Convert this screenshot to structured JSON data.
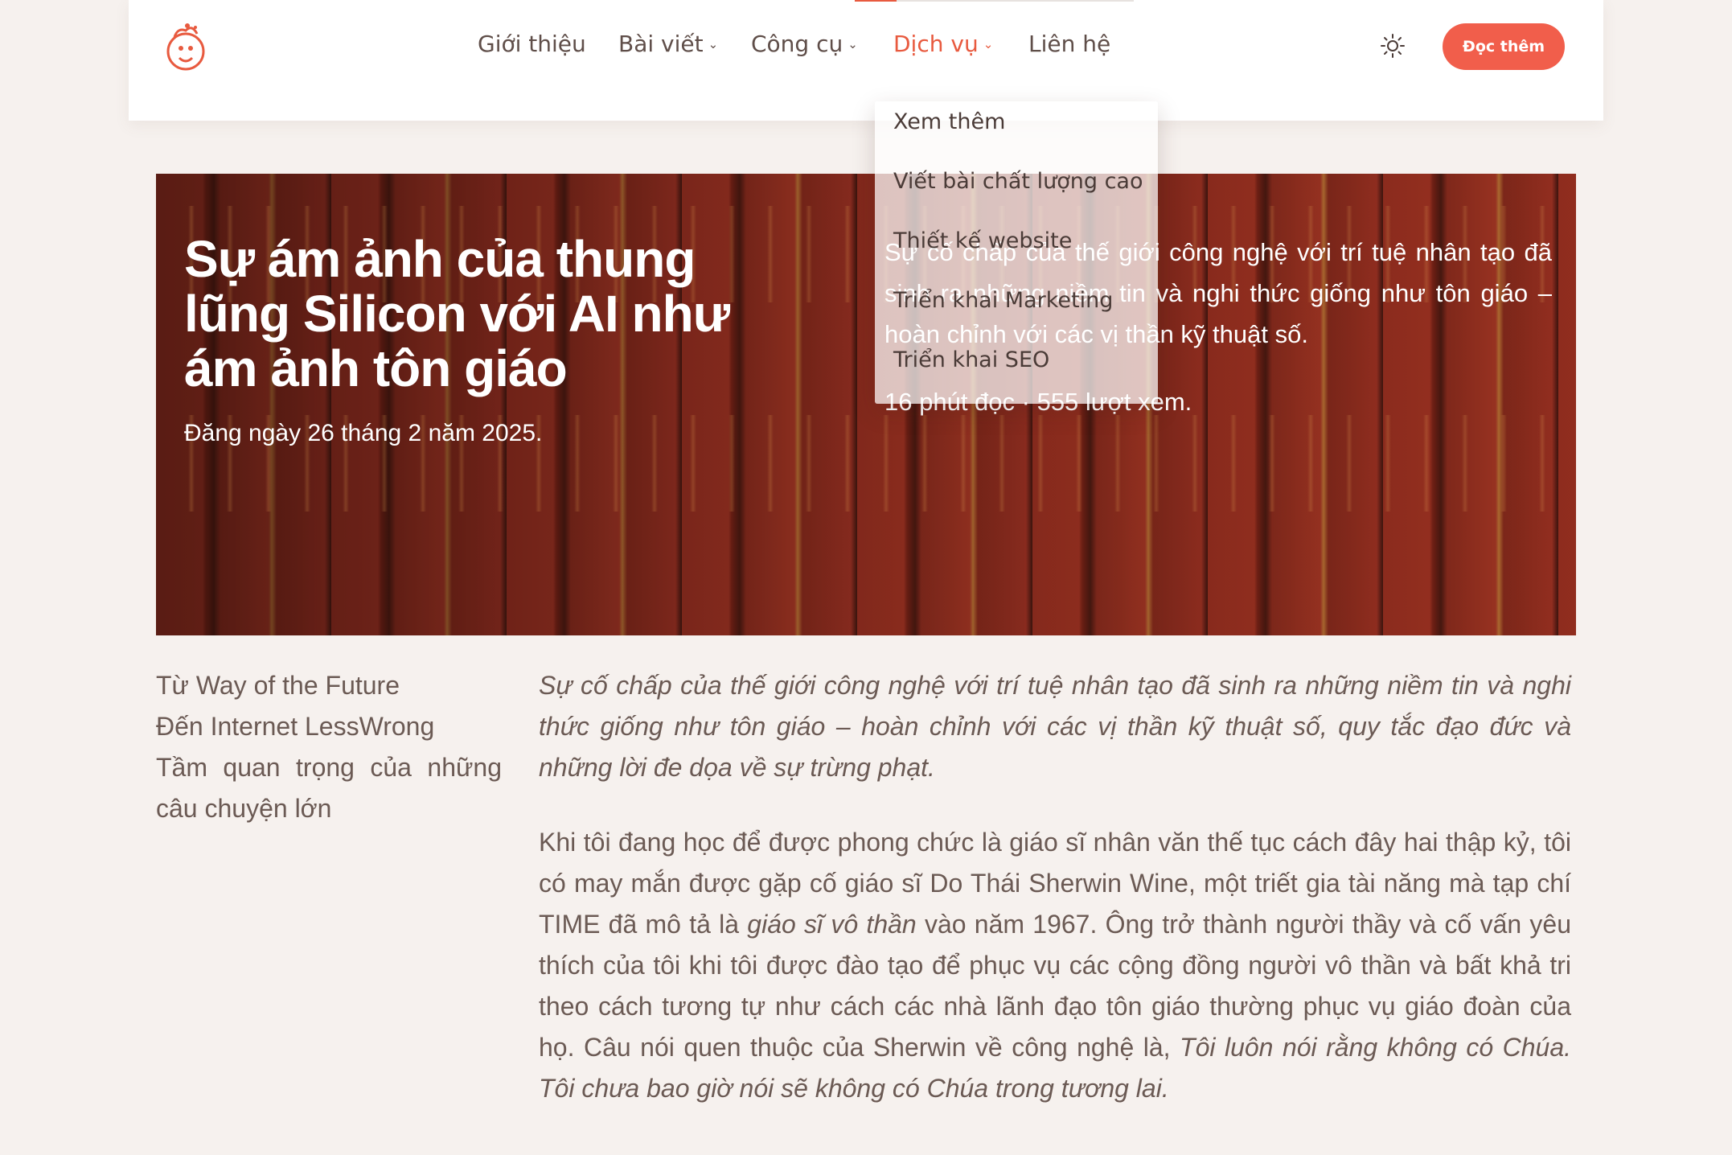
{
  "header": {
    "reading_progress": 0.15,
    "nav": [
      {
        "label": "Giới thiệu",
        "has_dropdown": false
      },
      {
        "label": "Bài viết",
        "has_dropdown": true
      },
      {
        "label": "Công cụ",
        "has_dropdown": true
      },
      {
        "label": "Dịch vụ",
        "has_dropdown": true,
        "active": true
      },
      {
        "label": "Liên hệ",
        "has_dropdown": false
      }
    ],
    "theme_icon": "sun-icon",
    "cta_label": "Đọc thêm"
  },
  "dropdown": {
    "items": [
      "Xem thêm",
      "Viết bài chất lượng cao",
      "Thiết kế website",
      "Triển khai Marketing",
      "Triển khai SEO"
    ]
  },
  "hero": {
    "title": "Sự ám ảnh của thung lũng Silicon với AI như ám ảnh tôn giáo",
    "date": "Đăng ngày 26 tháng 2 năm 2025.",
    "summary": "Sự cố chấp của thế giới công nghệ với trí tuệ nhân tạo đã sinh ra những niềm tin và nghi thức giống như tôn giáo – hoàn chỉnh với các vị thần kỹ thuật số.",
    "meta": "16 phút đọc · 555 lượt xem."
  },
  "toc": [
    "Từ Way of the Future",
    "Đến Internet LessWrong",
    "Tầm quan trọng của những câu chuyện lớn"
  ],
  "article": {
    "lead": "Sự cố chấp của thế giới công nghệ với trí tuệ nhân tạo đã sinh ra những niềm tin và nghi thức giống như tôn giáo – hoàn chỉnh với các vị thần kỹ thuật số, quy tắc đạo đức và những lời đe dọa về sự trừng phạt.",
    "p1_a": "Khi tôi đang học để được phong chức là giáo sĩ nhân văn thế tục cách đây hai thập kỷ, tôi có may mắn được gặp cố giáo sĩ Do Thái Sherwin Wine, một triết gia tài năng mà tạp chí TIME đã mô tả là ",
    "p1_em1": "giáo sĩ vô thần",
    "p1_b": " vào năm 1967. Ông trở thành người thầy và cố vấn yêu thích của tôi khi tôi được đào tạo để phục vụ các cộng đồng người vô thần và bất khả tri theo cách tương tự như cách các nhà lãnh đạo tôn giáo thường phục vụ giáo đoàn của họ. Câu nói quen thuộc của Sherwin về công nghệ là, ",
    "p1_em2": "Tôi luôn nói rằng không có Chúa. Tôi chưa bao giờ nói sẽ không có Chúa trong tương lai."
  },
  "colors": {
    "accent": "#f15e4b",
    "active_nav": "#e85a3f",
    "text": "#6b5a54",
    "page_bg": "#f6f1ee"
  }
}
